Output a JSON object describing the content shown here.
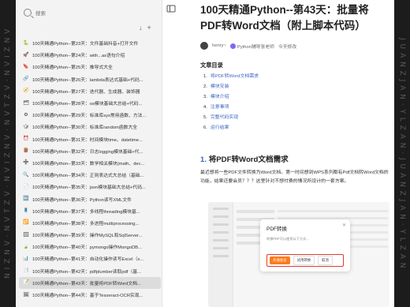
{
  "watermark": {
    "left": "N I Z N V · N V T Z V · N V I Z N V · N V T Z V · N V I Z N V",
    "right": "J U A N Z J A N · Y L Z A N · J U A N Z J A N · Y L Z A N"
  },
  "sidebar": {
    "search_placeholder": "搜索",
    "tools": {
      "sort": "↓",
      "add": "+"
    },
    "items": [
      {
        "num": "",
        "emoji": "🐍",
        "label": "100天精通Python--第23天：文件基础抖音+打开文件"
      },
      {
        "num": "",
        "emoji": "🚀",
        "label": "100天精通Python--第24天：with...as语句介绍"
      },
      {
        "num": "",
        "emoji": "🔖",
        "label": "100天精通Python--第25天：推导式大全"
      },
      {
        "num": "",
        "emoji": "🔗",
        "label": "100天精通Python--第26天：lambda表达式基础+代码..."
      },
      {
        "num": "",
        "emoji": "🧭",
        "label": "100天精通Python--第27天：迭代器、生成器、装饰器"
      },
      {
        "num": "",
        "emoji": "🗂",
        "label": "100天精通Python--第28天：os模块基础大总结+代码..."
      },
      {
        "num": "",
        "emoji": "⚙",
        "label": "100天精通Python--第29天：标准库sys常用函数、方法..."
      },
      {
        "num": "",
        "emoji": "🎲",
        "label": "100天精通Python--第30天：标准库random函数大全"
      },
      {
        "num": "",
        "emoji": "⏰",
        "label": "100天精通Python--第31天：时间模块time、datetime..."
      },
      {
        "num": "",
        "emoji": "🪵",
        "label": "100天精通Python--第32天：日志logging模块基础+代..."
      },
      {
        "num": "",
        "emoji": "➗",
        "label": "100天精通Python--第33天：数学相关模块(math、dec..."
      },
      {
        "num": "",
        "emoji": "🔍",
        "label": "100天精通Python--第34天：正则表达式大总结（基础..."
      },
      {
        "num": "",
        "emoji": "📄",
        "label": "100天精通Python--第35天：json模块基础大总结+代码..."
      },
      {
        "num": "",
        "emoji": "🔤",
        "label": "100天精通Python--第36天：Python读写XML文件"
      },
      {
        "num": "",
        "emoji": "🧵",
        "label": "100天精通Python--第37天：多线程threading模块基..."
      },
      {
        "num": "",
        "emoji": "🔁",
        "label": "100天精通Python--第38天：多进程multiprocessing..."
      },
      {
        "num": "",
        "emoji": "🗄",
        "label": "100天精通Python--第39天：操作MySQL和SqlServer..."
      },
      {
        "num": "",
        "emoji": "🍃",
        "label": "100天精通Python--第40天：pymongo操作MongoDB..."
      },
      {
        "num": "",
        "emoji": "📊",
        "label": "100天精通Python--第41天：自动化操作读写Excel（x..."
      },
      {
        "num": "",
        "emoji": "📑",
        "label": "100天精通Python--第42天：pdfplumber读取pdf（基..."
      },
      {
        "num": "",
        "emoji": "📝",
        "label": "100天精通Python--第43天：批量将PDF转Word文档..."
      },
      {
        "num": "",
        "emoji": "🖼",
        "label": "100天精通Python--第44天：基于Tesseract-OCR实现..."
      }
    ]
  },
  "article": {
    "title": "100天精通Python--第43天：批量将PDF转Word文档（附上脚本代码）",
    "author": "henry~",
    "tag": "Python辅导张老师",
    "date": "今天修改",
    "toc_heading": "文章目录",
    "toc": [
      {
        "n": "1.",
        "text": "将PDF转Word文档需求"
      },
      {
        "n": "2.",
        "text": "模块安装"
      },
      {
        "n": "3.",
        "text": "模块介绍"
      },
      {
        "n": "4.",
        "text": "注意事项"
      },
      {
        "n": "5.",
        "text": "完整代码实现"
      },
      {
        "n": "6.",
        "text": "运行结果"
      }
    ],
    "section_num": "1.",
    "section_title": "将PDF转Word文档需求",
    "paragraph": "最近想将一些PDF文件转换为Word文档。第一时间想到WPS系列都有Pdf文档转Word文档的功能，结果还要会员？？？这里针对不想付费的情况所设计的一套方案。",
    "dialog": {
      "title": "PDF转换",
      "subtitle": "转换PDF可以使用以下方式...",
      "btn_primary": "开通会员",
      "btn_secondary": "试用转换",
      "btn_cancel": "取消"
    }
  }
}
